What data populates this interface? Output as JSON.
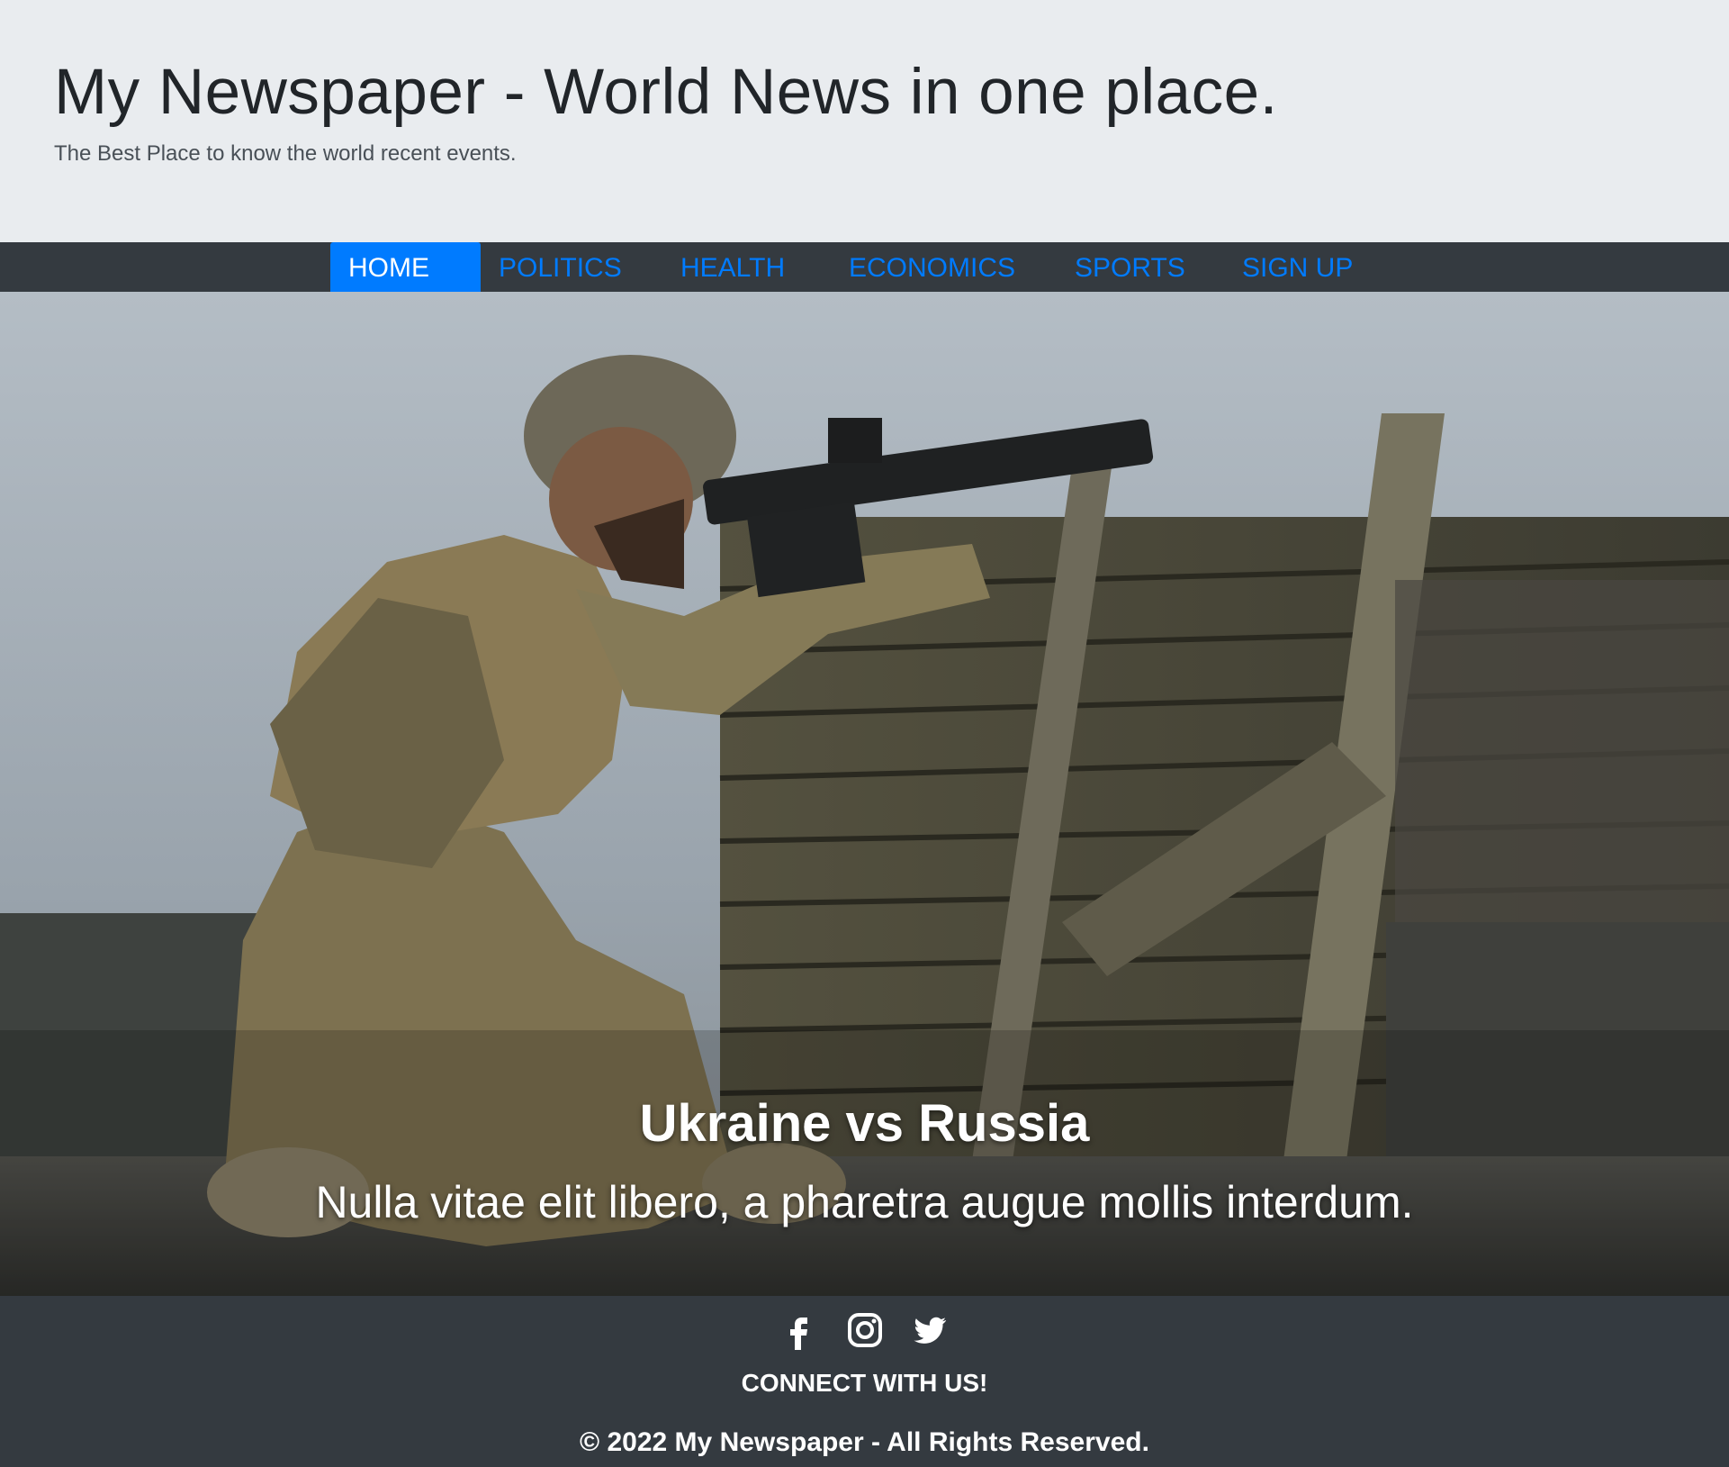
{
  "header": {
    "title": "My Newspaper - World News in one place.",
    "tagline": "The Best Place to know the world recent events."
  },
  "nav": {
    "items": [
      {
        "label": "HOME",
        "active": true
      },
      {
        "label": "POLITICS"
      },
      {
        "label": "HEALTH"
      },
      {
        "label": "ECONOMICS"
      },
      {
        "label": "SPORTS"
      },
      {
        "label": "SIGN UP"
      }
    ]
  },
  "hero": {
    "image": "soldier-kneeling-with-rifle-behind-wooden-barricade",
    "title": "Ukraine vs Russia",
    "text": "Nulla vitae elit libero, a pharetra augue mollis interdum."
  },
  "footer": {
    "social": [
      "facebook-icon",
      "instagram-icon",
      "twitter-icon"
    ],
    "connect": "CONNECT WITH US!",
    "copyright": "© 2022 My Newspaper - All Rights Reserved."
  },
  "colors": {
    "nav_bg": "#343a40",
    "link": "#007bff",
    "header_bg": "#e9ecef"
  }
}
